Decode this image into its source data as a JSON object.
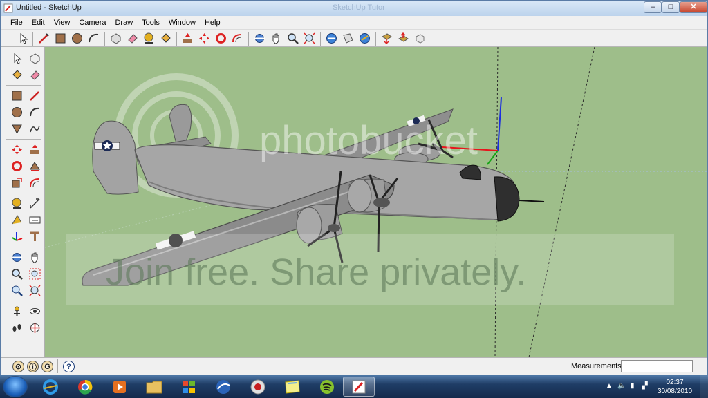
{
  "window": {
    "title": "Untitled - SketchUp",
    "ghost_title": "SketchUp Tutor"
  },
  "window_controls": {
    "minimize": "‒",
    "maximize": "□",
    "close": "✕"
  },
  "menu": [
    "File",
    "Edit",
    "View",
    "Camera",
    "Draw",
    "Tools",
    "Window",
    "Help"
  ],
  "statusbar": {
    "measurements_label": "Measurements",
    "measurements_value": "",
    "geo_icon": "G",
    "help_icon": "?"
  },
  "viewport": {
    "watermark_brand": "photobucket",
    "watermark_tagline": "Join free. Share privately.",
    "background_color": "#9ebe8a",
    "model": "B-24 Liberator bomber"
  },
  "taskbar": {
    "time": "02:37",
    "date": "30/08/2010"
  },
  "colors": {
    "axis_red": "#e8141c",
    "axis_green": "#18a518",
    "axis_blue": "#1c2ee0",
    "sky_ground": "#9ebe8a",
    "model_gray": "#9a9a9a"
  }
}
